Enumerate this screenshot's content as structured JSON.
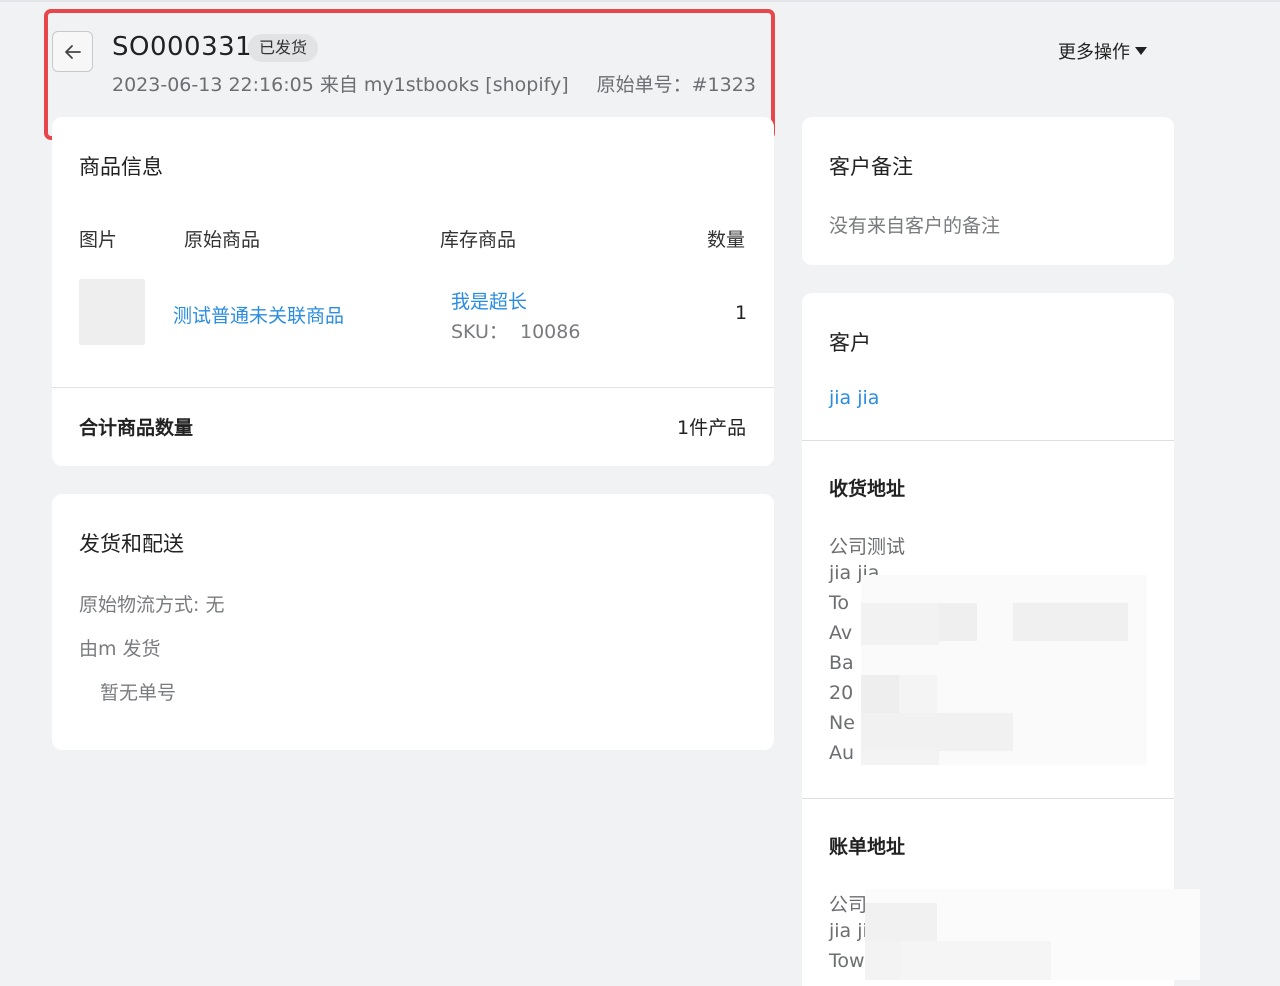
{
  "header": {
    "order_id": "SO000331",
    "status": "已发货",
    "meta": "2023-06-13 22:16:05 来自 my1stbooks [shopify]",
    "original_order": "原始单号：#1323",
    "more_actions": "更多操作"
  },
  "products": {
    "title": "商品信息",
    "columns": {
      "image": "图片",
      "original": "原始商品",
      "inventory": "库存商品",
      "quantity": "数量"
    },
    "item": {
      "original_name": "测试普通未关联商品",
      "inventory_name": "我是超长",
      "sku": "SKU：  10086",
      "quantity": "1"
    },
    "total_label": "合计商品数量",
    "total_value": "1件产品"
  },
  "shipping": {
    "title": "发货和配送",
    "method": "原始物流方式: 无",
    "shipper": "由m 发货",
    "tracking": "暂无单号"
  },
  "notes": {
    "title": "客户备注",
    "empty": "没有来自客户的备注"
  },
  "customer": {
    "title": "客户",
    "name": "jia jia",
    "shipping_title": "收货地址",
    "shipping_lines": [
      "公司测试",
      "jia jia",
      "To",
      "Av",
      "Ba",
      "20",
      "Ne",
      "Au"
    ],
    "billing_title": "账单地址",
    "billing_lines": [
      "公司",
      "jia ji",
      "Tow"
    ]
  }
}
